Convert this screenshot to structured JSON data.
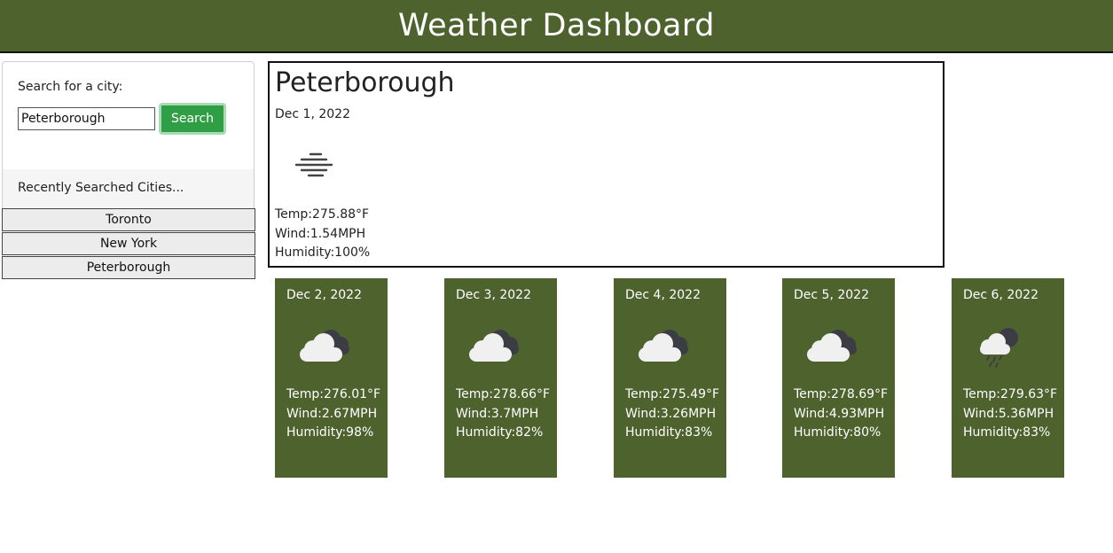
{
  "header": {
    "title": "Weather Dashboard"
  },
  "sidebar": {
    "search_label": "Search for a city:",
    "search_value": "Peterborough",
    "search_button": "Search",
    "recent_label": "Recently Searched Cities...",
    "recent": [
      "Toronto",
      "New York",
      "Peterborough"
    ]
  },
  "current": {
    "city": "Peterborough",
    "date": "Dec 1, 2022",
    "icon": "mist-icon",
    "temp": "Temp:275.88°F",
    "wind": "Wind:1.54MPH",
    "humidity": "Humidity:100%"
  },
  "forecast": [
    {
      "date": "Dec 2, 2022",
      "icon": "broken-clouds-icon",
      "temp": "Temp:276.01°F",
      "wind": "Wind:2.67MPH",
      "humidity": "Humidity:98%"
    },
    {
      "date": "Dec 3, 2022",
      "icon": "broken-clouds-icon",
      "temp": "Temp:278.66°F",
      "wind": "Wind:3.7MPH",
      "humidity": "Humidity:82%"
    },
    {
      "date": "Dec 4, 2022",
      "icon": "broken-clouds-icon",
      "temp": "Temp:275.49°F",
      "wind": "Wind:3.26MPH",
      "humidity": "Humidity:83%"
    },
    {
      "date": "Dec 5, 2022",
      "icon": "broken-clouds-icon",
      "temp": "Temp:278.69°F",
      "wind": "Wind:4.93MPH",
      "humidity": "Humidity:80%"
    },
    {
      "date": "Dec 6, 2022",
      "icon": "rain-icon",
      "temp": "Temp:279.63°F",
      "wind": "Wind:5.36MPH",
      "humidity": "Humidity:83%"
    }
  ],
  "colors": {
    "accent": "#4d622d",
    "button": "#2f9e44"
  }
}
